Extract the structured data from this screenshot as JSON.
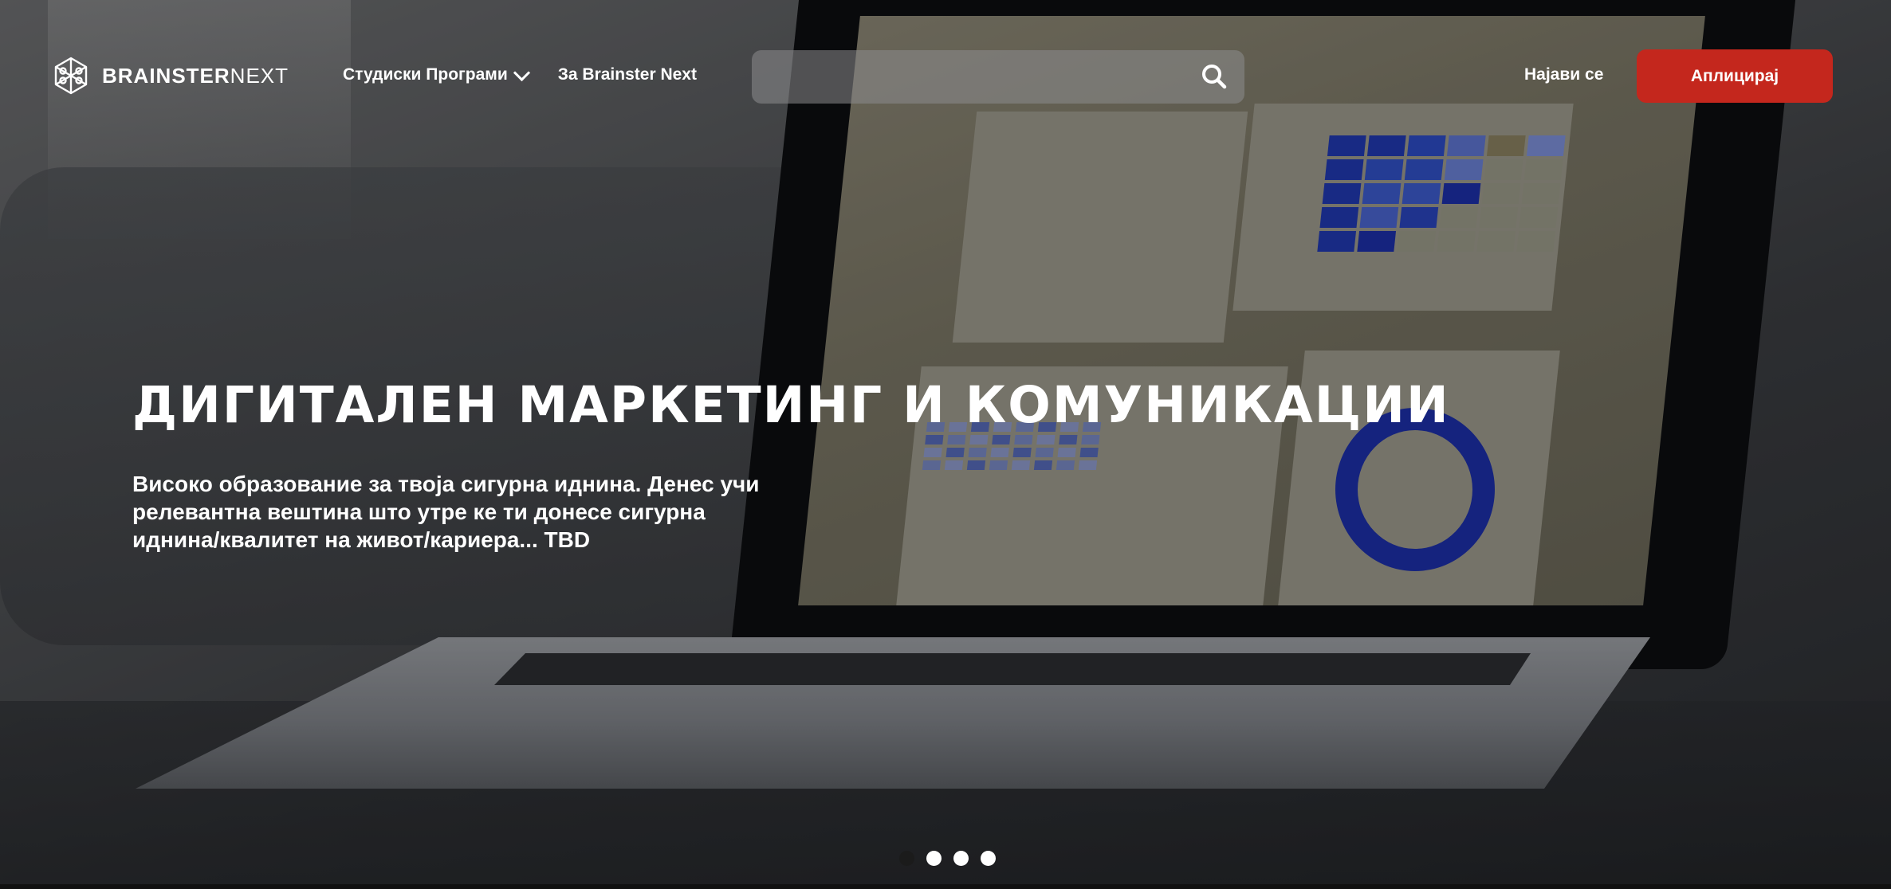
{
  "header": {
    "logo_bold": "BRAINSTER",
    "logo_light": "NEXT",
    "nav": [
      {
        "label": "Студиски Програми"
      },
      {
        "label": "За Brainster Next"
      }
    ],
    "search": {
      "placeholder": ""
    },
    "login_label": "Најави се",
    "apply_label": "Аплицирај"
  },
  "hero": {
    "title": "ДИГИТАЛЕН МАРКЕТИНГ И КОМУНИКАЦИИ",
    "subtitle": "Високо образование за твоја сигурна иднина. Денес учи релевантна вештина што утре ке ти донесе сигурна иднина/квалитет на живот/кариера... TBD"
  },
  "slider": {
    "total": 4,
    "active_index": 0
  },
  "colors": {
    "accent": "#c4271d",
    "text": "#ffffff"
  },
  "icons": [
    "brain-logo-icon",
    "chevron-down-icon",
    "search-icon"
  ]
}
